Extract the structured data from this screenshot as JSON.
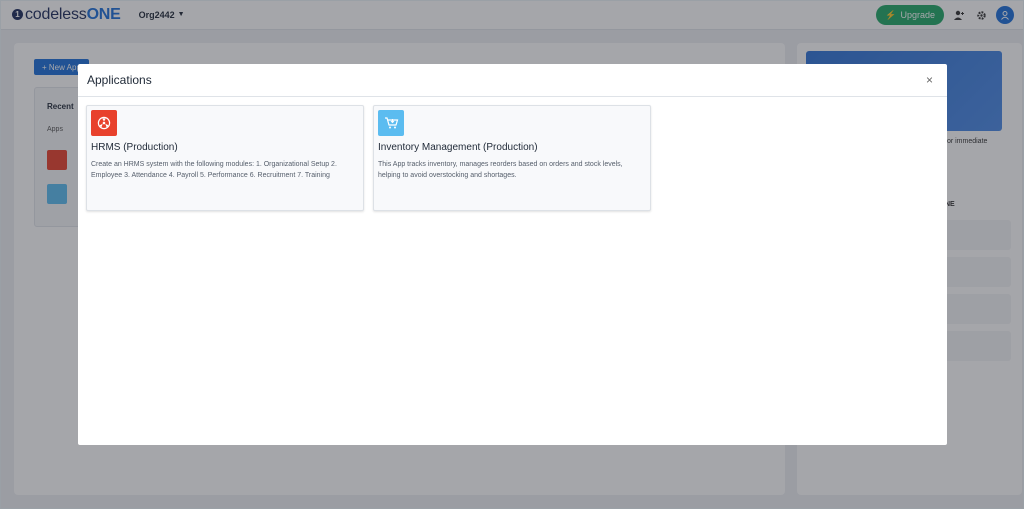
{
  "topbar": {
    "logo_text_a": "codeless",
    "logo_text_b": "ONE",
    "org_name": "Org2442",
    "upgrade_label": "Upgrade"
  },
  "background": {
    "new_app_label": "+ New App",
    "recent_title": "Recent",
    "recent_apps_label": "Apps",
    "side_text_1": "for immediate",
    "side_text_2": "NE"
  },
  "modal": {
    "title": "Applications",
    "close_label": "×",
    "apps": [
      {
        "name": "HRMS (Production)",
        "description": "Create an HRMS system with the following modules: 1. Organizational Setup 2. Employee 3. Attendance 4. Payroll 5. Performance 6. Recruitment 7. Training",
        "icon": "hrms-icon",
        "icon_color": "#e8412c"
      },
      {
        "name": "Inventory Management (Production)",
        "description": "This App tracks inventory, manages reorders based on orders and stock levels, helping to avoid overstocking and shortages.",
        "icon": "cart-icon",
        "icon_color": "#5bbcf0"
      }
    ]
  }
}
